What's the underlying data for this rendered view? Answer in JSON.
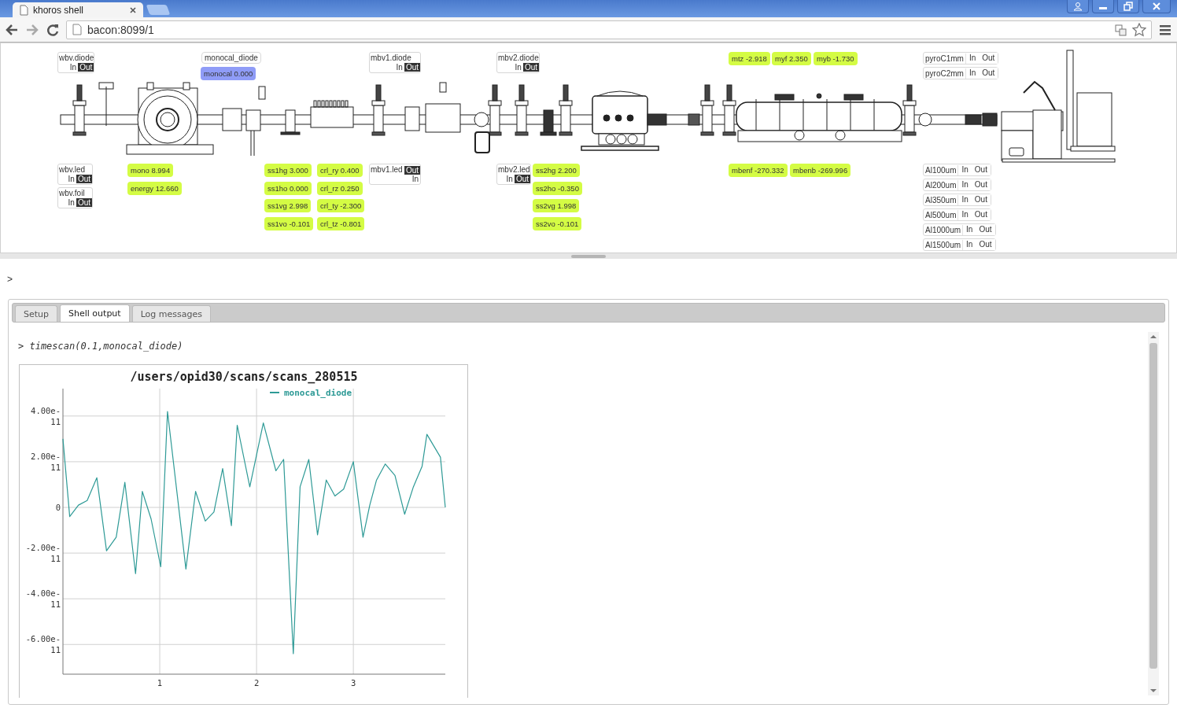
{
  "browser": {
    "tab_title": "khoros shell",
    "url": "bacon:8099/1"
  },
  "synoptic": {
    "widgets": [
      {
        "kind": "toggle",
        "label": "wbv.diode",
        "options": [
          {
            "label": "In",
            "selected": false
          },
          {
            "label": "Out",
            "selected": true
          }
        ]
      },
      {
        "kind": "label",
        "text": "monocal_diode"
      },
      {
        "kind": "value",
        "text": "monocal 0.000",
        "color": "#8f9cf7"
      },
      {
        "kind": "toggle",
        "label": "mbv1.diode",
        "options": [
          {
            "label": "In",
            "selected": false
          },
          {
            "label": "Out",
            "selected": true
          }
        ]
      },
      {
        "kind": "toggle",
        "label": "mbv2.diode",
        "options": [
          {
            "label": "In",
            "selected": false
          },
          {
            "label": "Out",
            "selected": true
          }
        ]
      },
      {
        "kind": "value",
        "text": "mtz -2.918",
        "color": "#d4fc44"
      },
      {
        "kind": "value",
        "text": "myf 2.350",
        "color": "#d4fc44"
      },
      {
        "kind": "value",
        "text": "myb -1.730",
        "color": "#d4fc44"
      },
      {
        "kind": "toggle-inline",
        "label": "pyroC1mm",
        "options": [
          {
            "label": "In",
            "selected": false
          },
          {
            "label": "Out",
            "selected": false
          }
        ]
      },
      {
        "kind": "toggle-inline",
        "label": "pyroC2mm",
        "options": [
          {
            "label": "In",
            "selected": false
          },
          {
            "label": "Out",
            "selected": false
          }
        ]
      },
      {
        "kind": "toggle",
        "label": "wbv.led",
        "options": [
          {
            "label": "In",
            "selected": false
          },
          {
            "label": "Out",
            "selected": true
          }
        ]
      },
      {
        "kind": "toggle",
        "label": "wbv.foil",
        "options": [
          {
            "label": "In",
            "selected": false
          },
          {
            "label": "Out",
            "selected": true
          }
        ]
      },
      {
        "kind": "value",
        "text": "mono 8.994",
        "color": "#d4fc44"
      },
      {
        "kind": "value",
        "text": "energy 12.660",
        "color": "#d4fc44"
      },
      {
        "kind": "value",
        "text": "ss1hg 3.000",
        "color": "#d4fc44"
      },
      {
        "kind": "value",
        "text": "ss1ho 0.000",
        "color": "#d4fc44"
      },
      {
        "kind": "value",
        "text": "ss1vg 2.998",
        "color": "#d4fc44"
      },
      {
        "kind": "value",
        "text": "ss1vo -0.101",
        "color": "#d4fc44"
      },
      {
        "kind": "value",
        "text": "crl_ry 0.400",
        "color": "#d4fc44"
      },
      {
        "kind": "value",
        "text": "crl_rz 0.250",
        "color": "#d4fc44"
      },
      {
        "kind": "value",
        "text": "crl_ty -2.300",
        "color": "#d4fc44"
      },
      {
        "kind": "value",
        "text": "crl_tz -0.801",
        "color": "#d4fc44"
      },
      {
        "kind": "toggle-split",
        "label": "mbv1.led",
        "options": [
          {
            "label": "Out",
            "selected": true
          },
          {
            "label": "In",
            "selected": false
          }
        ]
      },
      {
        "kind": "toggle",
        "label": "mbv2.led",
        "options": [
          {
            "label": "In",
            "selected": false
          },
          {
            "label": "Out",
            "selected": true
          }
        ]
      },
      {
        "kind": "value",
        "text": "ss2hg 2.200",
        "color": "#d4fc44"
      },
      {
        "kind": "value",
        "text": "ss2ho -0.350",
        "color": "#d4fc44"
      },
      {
        "kind": "value",
        "text": "ss2vg 1.998",
        "color": "#d4fc44"
      },
      {
        "kind": "value",
        "text": "ss2vo -0.101",
        "color": "#d4fc44"
      },
      {
        "kind": "value",
        "text": "mbenf -270.332",
        "color": "#d4fc44"
      },
      {
        "kind": "value",
        "text": "mbenb -269.996",
        "color": "#d4fc44"
      },
      {
        "kind": "toggle-inline",
        "label": "Al100um",
        "options": [
          {
            "label": "In",
            "selected": false
          },
          {
            "label": "Out",
            "selected": false
          }
        ]
      },
      {
        "kind": "toggle-inline",
        "label": "Al200um",
        "options": [
          {
            "label": "In",
            "selected": false
          },
          {
            "label": "Out",
            "selected": false
          }
        ]
      },
      {
        "kind": "toggle-inline",
        "label": "Al350um",
        "options": [
          {
            "label": "In",
            "selected": false
          },
          {
            "label": "Out",
            "selected": false
          }
        ]
      },
      {
        "kind": "toggle-inline",
        "label": "Al500um",
        "options": [
          {
            "label": "In",
            "selected": false
          },
          {
            "label": "Out",
            "selected": false
          }
        ]
      },
      {
        "kind": "toggle-inline",
        "label": "Al1000um",
        "options": [
          {
            "label": "In",
            "selected": false
          },
          {
            "label": "Out",
            "selected": false
          }
        ]
      },
      {
        "kind": "toggle-inline",
        "label": "Al1500um",
        "options": [
          {
            "label": "In",
            "selected": false
          },
          {
            "label": "Out",
            "selected": false
          }
        ]
      }
    ]
  },
  "shell": {
    "prompt": ">",
    "tabs": [
      {
        "label": "Setup",
        "selected": false
      },
      {
        "label": "Shell output",
        "selected": true
      },
      {
        "label": "Log messages",
        "selected": false
      }
    ],
    "output": {
      "command": "> timescan(0.1,monocal_diode)",
      "chart_data": {
        "type": "line",
        "title": "/users/opid30/scans/scans_280515",
        "x": [
          0,
          0.07,
          0.16,
          0.25,
          0.35,
          0.45,
          0.55,
          0.64,
          0.75,
          0.82,
          0.91,
          1.01,
          1.08,
          1.27,
          1.37,
          1.47,
          1.56,
          1.65,
          1.74,
          1.8,
          1.93,
          2.07,
          2.2,
          2.28,
          2.38,
          2.45,
          2.54,
          2.63,
          2.72,
          2.81,
          2.9,
          3.0,
          3.1,
          3.17,
          3.24,
          3.33,
          3.43,
          3.53,
          3.62,
          3.71,
          3.76,
          3.9,
          3.95
        ],
        "series": [
          {
            "name": "monocal_diode",
            "color": "#2e9a96",
            "values": [
              3e-11,
              -4e-12,
              1e-12,
              3e-12,
              1.3e-11,
              -1.9e-11,
              -1.3e-11,
              1.1e-11,
              -2.9e-11,
              7e-12,
              -5e-12,
              -2.6e-11,
              4.2e-11,
              -2.7e-11,
              7e-12,
              -6e-12,
              -2e-12,
              1.7e-11,
              -8e-12,
              3.6e-11,
              9e-12,
              3.7e-11,
              1.6e-11,
              2.1e-11,
              -6.4e-11,
              9e-12,
              2.1e-11,
              -1.2e-11,
              1.2e-11,
              5e-12,
              8e-12,
              2e-11,
              -1.3e-11,
              1e-12,
              1.2e-11,
              1.9e-11,
              1.4e-11,
              -3e-12,
              9e-12,
              1.8e-11,
              3.2e-11,
              2.2e-11,
              0
            ]
          }
        ],
        "xlim": [
          0,
          3.95
        ],
        "ylim": [
          -7.3e-11,
          5.2e-11
        ],
        "xticks": [
          1,
          2,
          3
        ],
        "grid": true,
        "yticks": [
          {
            "value": 4e-11,
            "label": "4.00e-11"
          },
          {
            "value": 2e-11,
            "label": "2.00e-11"
          },
          {
            "value": 0,
            "label": "0"
          },
          {
            "value": -2e-11,
            "label": "-2.00e-11"
          },
          {
            "value": -4e-11,
            "label": "-4.00e-11"
          },
          {
            "value": -6e-11,
            "label": "-6.00e-11"
          }
        ]
      }
    }
  }
}
